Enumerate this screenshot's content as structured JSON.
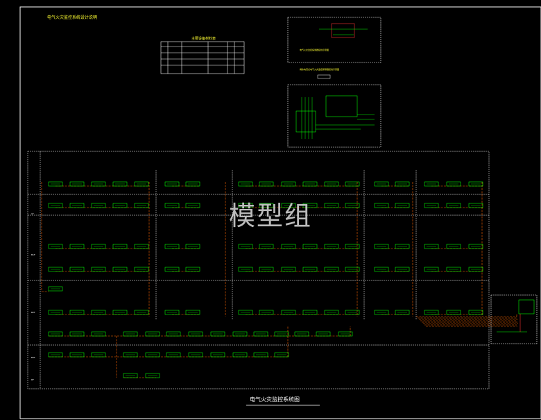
{
  "drawing": {
    "title": "电气火灾监控系统图",
    "watermark": "模型组",
    "notes_title": "电气火灾监控系统设计说明",
    "equipment_table_title": "主要设备材料表",
    "detail_top_caption": "电气火灾监控探测器接线示意图",
    "detail_bottom_caption": "剩余电流式电气火灾监控探测器接线示意图"
  },
  "colors": {
    "background": "#000000",
    "frame": "#ffffff",
    "module": "#00ff00",
    "bus_line": "#ff6600",
    "notes": "#ffff33"
  },
  "floor_labels": [
    "1F",
    "B1F",
    "B2F",
    "B3F",
    "RF"
  ]
}
